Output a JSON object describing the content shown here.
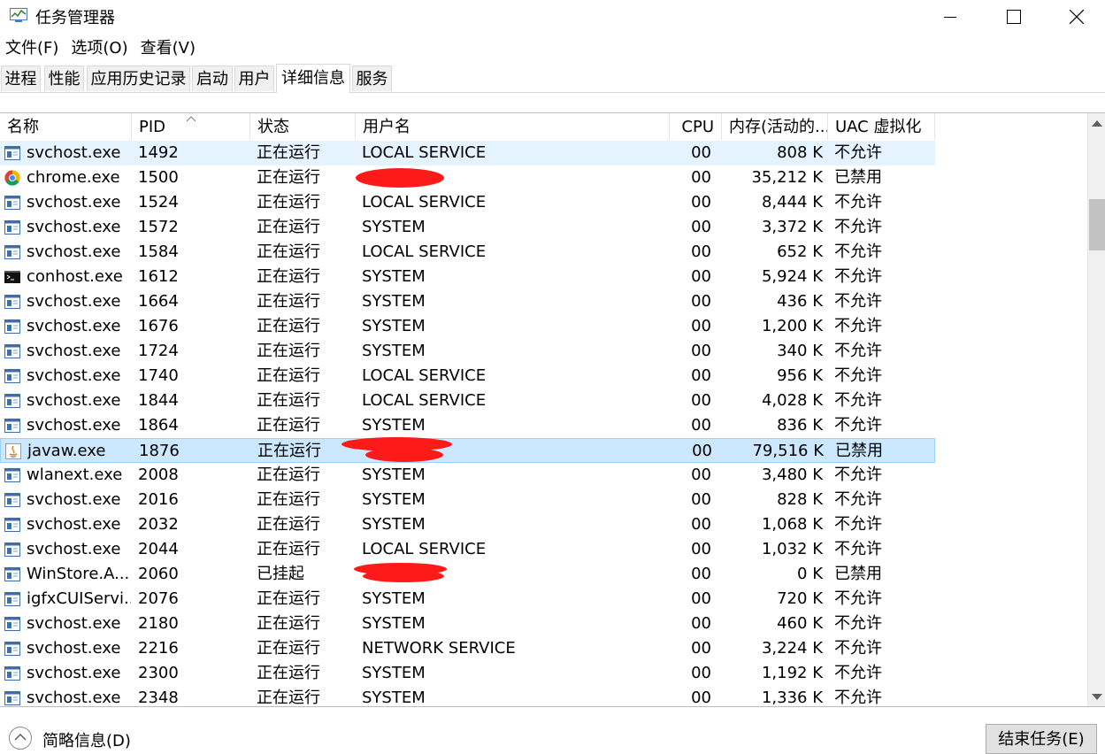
{
  "window": {
    "title": "任务管理器",
    "minimize_icon": "minimize-icon",
    "maximize_icon": "maximize-icon",
    "close_icon": "close-icon"
  },
  "menu": [
    "文件(F)",
    "选项(O)",
    "查看(V)"
  ],
  "tabs": [
    {
      "label": "进程",
      "active": false
    },
    {
      "label": "性能",
      "active": false
    },
    {
      "label": "应用历史记录",
      "active": false
    },
    {
      "label": "启动",
      "active": false
    },
    {
      "label": "用户",
      "active": false
    },
    {
      "label": "详细信息",
      "active": true
    },
    {
      "label": "服务",
      "active": false
    }
  ],
  "columns": {
    "name": "名称",
    "pid": "PID",
    "status": "状态",
    "user": "用户名",
    "cpu": "CPU",
    "memory": "内存(活动的...",
    "uac": "UAC 虚拟化"
  },
  "rows": [
    {
      "name": "svchost.exe",
      "pid": "1492",
      "status": "正在运行",
      "user": "LOCAL SERVICE",
      "cpu": "00",
      "memory": "808 K",
      "uac": "不允许",
      "icon": "service-icon",
      "state": "hover"
    },
    {
      "name": "chrome.exe",
      "pid": "1500",
      "status": "正在运行",
      "user": "",
      "cpu": "00",
      "memory": "35,212 K",
      "uac": "已禁用",
      "icon": "chrome-icon",
      "redacted": true
    },
    {
      "name": "svchost.exe",
      "pid": "1524",
      "status": "正在运行",
      "user": "LOCAL SERVICE",
      "cpu": "00",
      "memory": "8,444 K",
      "uac": "不允许",
      "icon": "service-icon"
    },
    {
      "name": "svchost.exe",
      "pid": "1572",
      "status": "正在运行",
      "user": "SYSTEM",
      "cpu": "00",
      "memory": "3,372 K",
      "uac": "不允许",
      "icon": "service-icon"
    },
    {
      "name": "svchost.exe",
      "pid": "1584",
      "status": "正在运行",
      "user": "LOCAL SERVICE",
      "cpu": "00",
      "memory": "652 K",
      "uac": "不允许",
      "icon": "service-icon"
    },
    {
      "name": "conhost.exe",
      "pid": "1612",
      "status": "正在运行",
      "user": "SYSTEM",
      "cpu": "00",
      "memory": "5,924 K",
      "uac": "不允许",
      "icon": "console-icon"
    },
    {
      "name": "svchost.exe",
      "pid": "1664",
      "status": "正在运行",
      "user": "SYSTEM",
      "cpu": "00",
      "memory": "436 K",
      "uac": "不允许",
      "icon": "service-icon"
    },
    {
      "name": "svchost.exe",
      "pid": "1676",
      "status": "正在运行",
      "user": "SYSTEM",
      "cpu": "00",
      "memory": "1,200 K",
      "uac": "不允许",
      "icon": "service-icon"
    },
    {
      "name": "svchost.exe",
      "pid": "1724",
      "status": "正在运行",
      "user": "SYSTEM",
      "cpu": "00",
      "memory": "340 K",
      "uac": "不允许",
      "icon": "service-icon"
    },
    {
      "name": "svchost.exe",
      "pid": "1740",
      "status": "正在运行",
      "user": "LOCAL SERVICE",
      "cpu": "00",
      "memory": "956 K",
      "uac": "不允许",
      "icon": "service-icon"
    },
    {
      "name": "svchost.exe",
      "pid": "1844",
      "status": "正在运行",
      "user": "LOCAL SERVICE",
      "cpu": "00",
      "memory": "4,028 K",
      "uac": "不允许",
      "icon": "service-icon"
    },
    {
      "name": "svchost.exe",
      "pid": "1864",
      "status": "正在运行",
      "user": "SYSTEM",
      "cpu": "00",
      "memory": "836 K",
      "uac": "不允许",
      "icon": "service-icon"
    },
    {
      "name": "javaw.exe",
      "pid": "1876",
      "status": "正在运行",
      "user": "",
      "cpu": "00",
      "memory": "79,516 K",
      "uac": "已禁用",
      "icon": "java-icon",
      "state": "selected",
      "redacted": true
    },
    {
      "name": "wlanext.exe",
      "pid": "2008",
      "status": "正在运行",
      "user": "SYSTEM",
      "cpu": "00",
      "memory": "3,480 K",
      "uac": "不允许",
      "icon": "service-icon"
    },
    {
      "name": "svchost.exe",
      "pid": "2016",
      "status": "正在运行",
      "user": "SYSTEM",
      "cpu": "00",
      "memory": "828 K",
      "uac": "不允许",
      "icon": "service-icon"
    },
    {
      "name": "svchost.exe",
      "pid": "2032",
      "status": "正在运行",
      "user": "SYSTEM",
      "cpu": "00",
      "memory": "1,068 K",
      "uac": "不允许",
      "icon": "service-icon"
    },
    {
      "name": "svchost.exe",
      "pid": "2044",
      "status": "正在运行",
      "user": "LOCAL SERVICE",
      "cpu": "00",
      "memory": "1,032 K",
      "uac": "不允许",
      "icon": "service-icon"
    },
    {
      "name": "WinStore.A...",
      "pid": "2060",
      "status": "已挂起",
      "user": "",
      "cpu": "00",
      "memory": "0 K",
      "uac": "已禁用",
      "icon": "service-icon",
      "redacted": true
    },
    {
      "name": "igfxCUIServi...",
      "pid": "2076",
      "status": "正在运行",
      "user": "SYSTEM",
      "cpu": "00",
      "memory": "720 K",
      "uac": "不允许",
      "icon": "service-icon"
    },
    {
      "name": "svchost.exe",
      "pid": "2180",
      "status": "正在运行",
      "user": "SYSTEM",
      "cpu": "00",
      "memory": "460 K",
      "uac": "不允许",
      "icon": "service-icon"
    },
    {
      "name": "svchost.exe",
      "pid": "2216",
      "status": "正在运行",
      "user": "NETWORK SERVICE",
      "cpu": "00",
      "memory": "3,224 K",
      "uac": "不允许",
      "icon": "service-icon"
    },
    {
      "name": "svchost.exe",
      "pid": "2300",
      "status": "正在运行",
      "user": "SYSTEM",
      "cpu": "00",
      "memory": "1,192 K",
      "uac": "不允许",
      "icon": "service-icon"
    },
    {
      "name": "svchost.exe",
      "pid": "2348",
      "status": "正在运行",
      "user": "SYSTEM",
      "cpu": "00",
      "memory": "1,336 K",
      "uac": "不允许",
      "icon": "service-icon"
    }
  ],
  "footer": {
    "fewer_details": "简略信息(D)",
    "end_task": "结束任务(E)"
  },
  "colors": {
    "hover_row": "#e5f3ff",
    "selected_row": "#cce8ff",
    "selected_border": "#99d1ff",
    "redaction": "#ff1a1a"
  }
}
